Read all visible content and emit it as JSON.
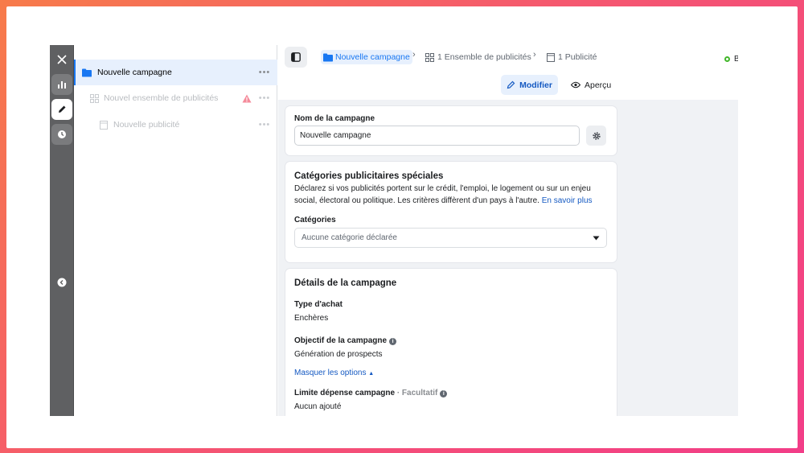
{
  "tree": {
    "campaign": "Nouvelle campagne",
    "adset": "Nouvel ensemble de publicités",
    "ad": "Nouvelle publicité",
    "more": "•••"
  },
  "breadcrumb": {
    "campaign": "Nouvelle campagne",
    "adset": "1 Ensemble de publicités",
    "ad": "1 Publicité"
  },
  "toolbar": {
    "edit_label": "Modifier",
    "preview_label": "Aperçu",
    "status_initial": "B"
  },
  "campaign_name": {
    "label": "Nom de la campagne",
    "value": "Nouvelle campagne"
  },
  "special_categories": {
    "title": "Catégories publicitaires spéciales",
    "description": "Déclarez si vos publicités portent sur le crédit, l'emploi, le logement ou sur un enjeu social, électoral ou politique. Les critères diffèrent d'un pays à l'autre.",
    "learn_more": "En savoir plus",
    "categories_label": "Catégories",
    "categories_value": "Aucune catégorie déclarée"
  },
  "details": {
    "title": "Détails de la campagne",
    "buying_type_label": "Type d'achat",
    "buying_type_value": "Enchères",
    "objective_label": "Objectif de la campagne",
    "objective_value": "Génération de prospects",
    "hide_options": "Masquer les options",
    "spend_limit_label": "Limite dépense campagne",
    "optional": "· Facultatif",
    "spend_limit_value": "Aucun ajouté"
  },
  "colors": {
    "accent": "#1877f2",
    "warning": "#f02849",
    "status": "#42b72a"
  }
}
